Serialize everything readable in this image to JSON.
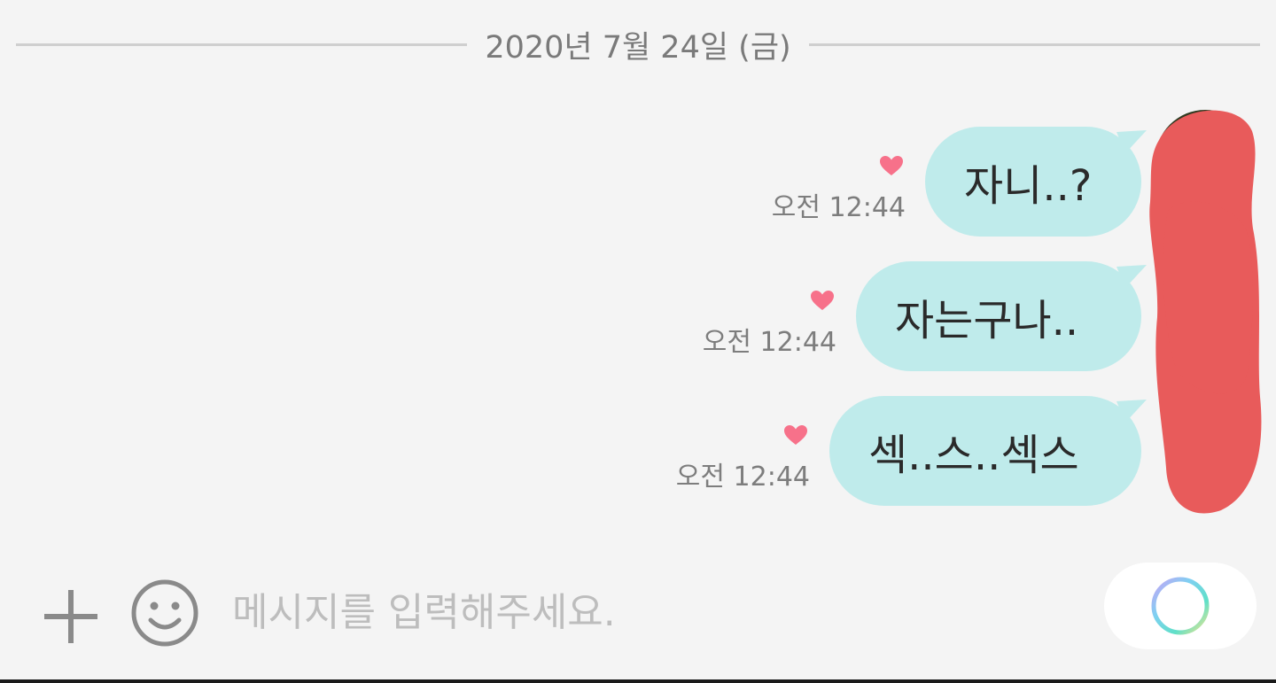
{
  "chat": {
    "date_divider": "2020년 7월 24일 (금)",
    "messages": [
      {
        "text": "자니..?",
        "time": "오전 12:44",
        "liked": true
      },
      {
        "text": "자는구나..",
        "time": "오전 12:44",
        "liked": true
      },
      {
        "text": "섹..스..섹스",
        "time": "오전 12:44",
        "liked": true
      }
    ]
  },
  "composer": {
    "placeholder": "메시지를 입력해주세요.",
    "value": ""
  },
  "icons": {
    "add": "plus-icon",
    "emoji": "smiley-icon",
    "send": "ring-icon",
    "like": "heart-icon"
  },
  "colors": {
    "background": "#f4f4f4",
    "bubble": "#bfebeb",
    "heart": "#f7718a",
    "avatar_redaction": "#e85b5b",
    "input_pill": "#ffffff"
  }
}
